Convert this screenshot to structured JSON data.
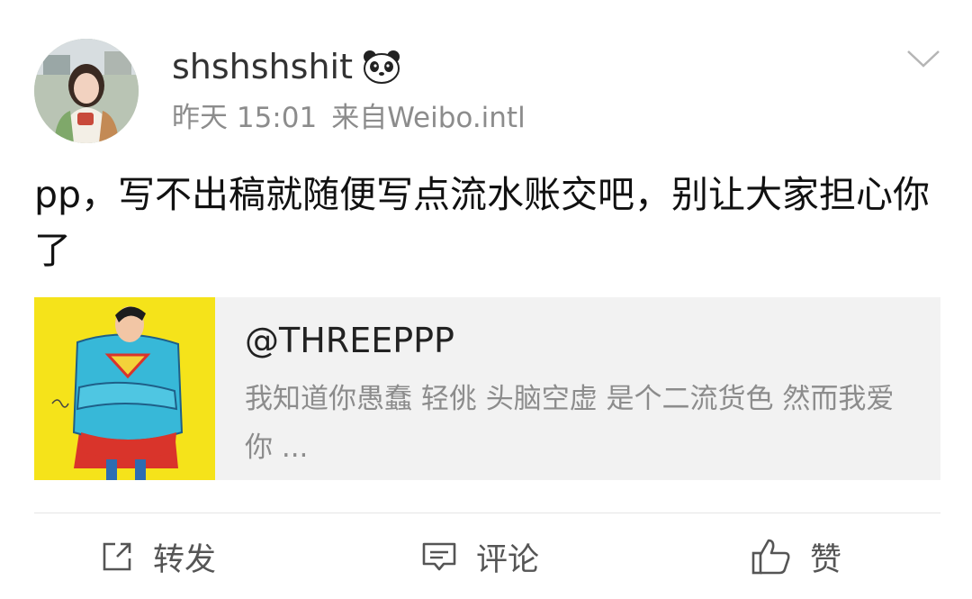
{
  "post": {
    "user": {
      "name": "shshshshit"
    },
    "meta": {
      "time": "昨天 15:01",
      "source": "来自Weibo.intl"
    },
    "text": "pp，写不出稿就随便写点流水账交吧，别让大家担心你了",
    "repost_card": {
      "title": "@THREEPPP",
      "description": "我知道你愚蠢 轻佻 头脑空虚 是个二流货色 然而我爱你 ..."
    },
    "actions": {
      "repost_label": "转发",
      "comment_label": "评论",
      "like_label": "赞"
    }
  },
  "icons": {
    "verified_badge": "panda-icon",
    "more": "chevron-down-icon",
    "repost": "share-arrow-icon",
    "comment": "comment-bubble-icon",
    "like": "thumbs-up-icon"
  },
  "colors": {
    "username": "#333333",
    "meta": "#8c8c8c",
    "card_background": "#f2f2f2",
    "thumbnail_background": "#f5e31a"
  }
}
